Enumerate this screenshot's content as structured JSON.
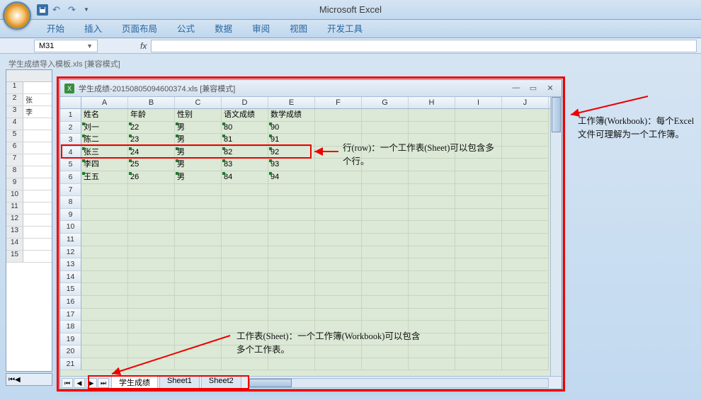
{
  "app_title": "Microsoft Excel",
  "ribbon_tabs": [
    "开始",
    "插入",
    "页面布局",
    "公式",
    "数据",
    "审阅",
    "视图",
    "开发工具"
  ],
  "namebox_value": "M31",
  "fx_label": "fx",
  "outer_doc_title": "学生成绩导入模板.xls  [兼容模式]",
  "outer_rows": [
    {
      "n": "1",
      "a": ""
    },
    {
      "n": "2",
      "a": "张"
    },
    {
      "n": "3",
      "a": "李"
    },
    {
      "n": "4",
      "a": ""
    },
    {
      "n": "5",
      "a": ""
    },
    {
      "n": "6",
      "a": ""
    },
    {
      "n": "7",
      "a": ""
    },
    {
      "n": "8",
      "a": ""
    },
    {
      "n": "9",
      "a": ""
    },
    {
      "n": "10",
      "a": ""
    },
    {
      "n": "11",
      "a": ""
    },
    {
      "n": "12",
      "a": ""
    },
    {
      "n": "13",
      "a": ""
    },
    {
      "n": "14",
      "a": ""
    },
    {
      "n": "15",
      "a": ""
    }
  ],
  "inner_title": "学生成绩-20150805094600374.xls  [兼容模式]",
  "columns": [
    "A",
    "B",
    "C",
    "D",
    "E",
    "F",
    "G",
    "H",
    "I",
    "J"
  ],
  "headers": [
    "姓名",
    "年龄",
    "性别",
    "语文成绩",
    "数学成绩"
  ],
  "grid": [
    [
      "刘一",
      "22",
      "男",
      "80",
      "90"
    ],
    [
      "陈二",
      "23",
      "男",
      "81",
      "91"
    ],
    [
      "张三",
      "24",
      "男",
      "82",
      "92"
    ],
    [
      "李四",
      "25",
      "男",
      "83",
      "93"
    ],
    [
      "王五",
      "26",
      "男",
      "84",
      "94"
    ]
  ],
  "blank_rows": 15,
  "sheet_tabs": [
    "学生成绩",
    "Sheet1",
    "Sheet2"
  ],
  "nav_glyphs": [
    "⏮",
    "◀",
    "▶",
    "⏭"
  ],
  "annotations": {
    "row": "行(row)：一个工作表(Sheet)可以包含多个行。",
    "sheet": "工作表(Sheet)：一个工作簿(Workbook)可以包含多个工作表。",
    "workbook": "工作簿(Workbook)：每个Excel文件可理解为一个工作簿。"
  },
  "win_controls": {
    "min": "—",
    "max": "▭",
    "close": "✕"
  }
}
